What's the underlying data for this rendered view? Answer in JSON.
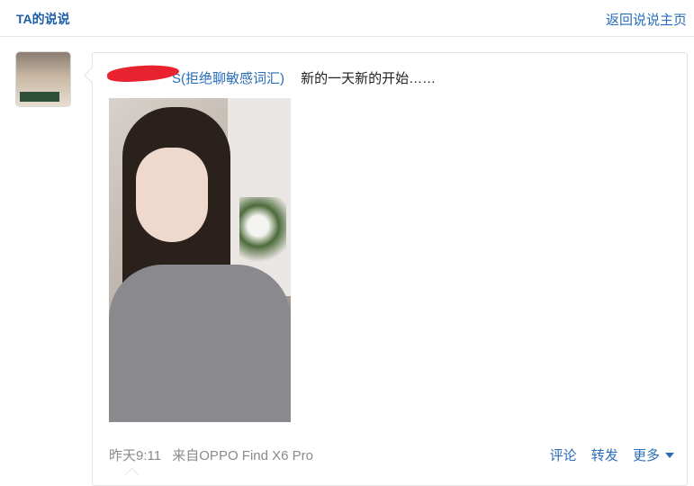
{
  "header": {
    "title": "TA的说说",
    "back_link": "返回说说主页"
  },
  "post": {
    "author_name_visible": "S(拒绝聊敏感词汇)",
    "text": "新的一天新的开始……",
    "timestamp": "昨天9:11",
    "source": "来自OPPO Find X6 Pro",
    "actions": {
      "comment": "评论",
      "forward": "转发",
      "more": "更多"
    }
  },
  "icons": {
    "more": "caret-down-icon"
  },
  "colors": {
    "link": "#2a6db8",
    "title": "#1f5fa8",
    "meta": "#8a8a8a",
    "redaction": "#e8232f"
  }
}
